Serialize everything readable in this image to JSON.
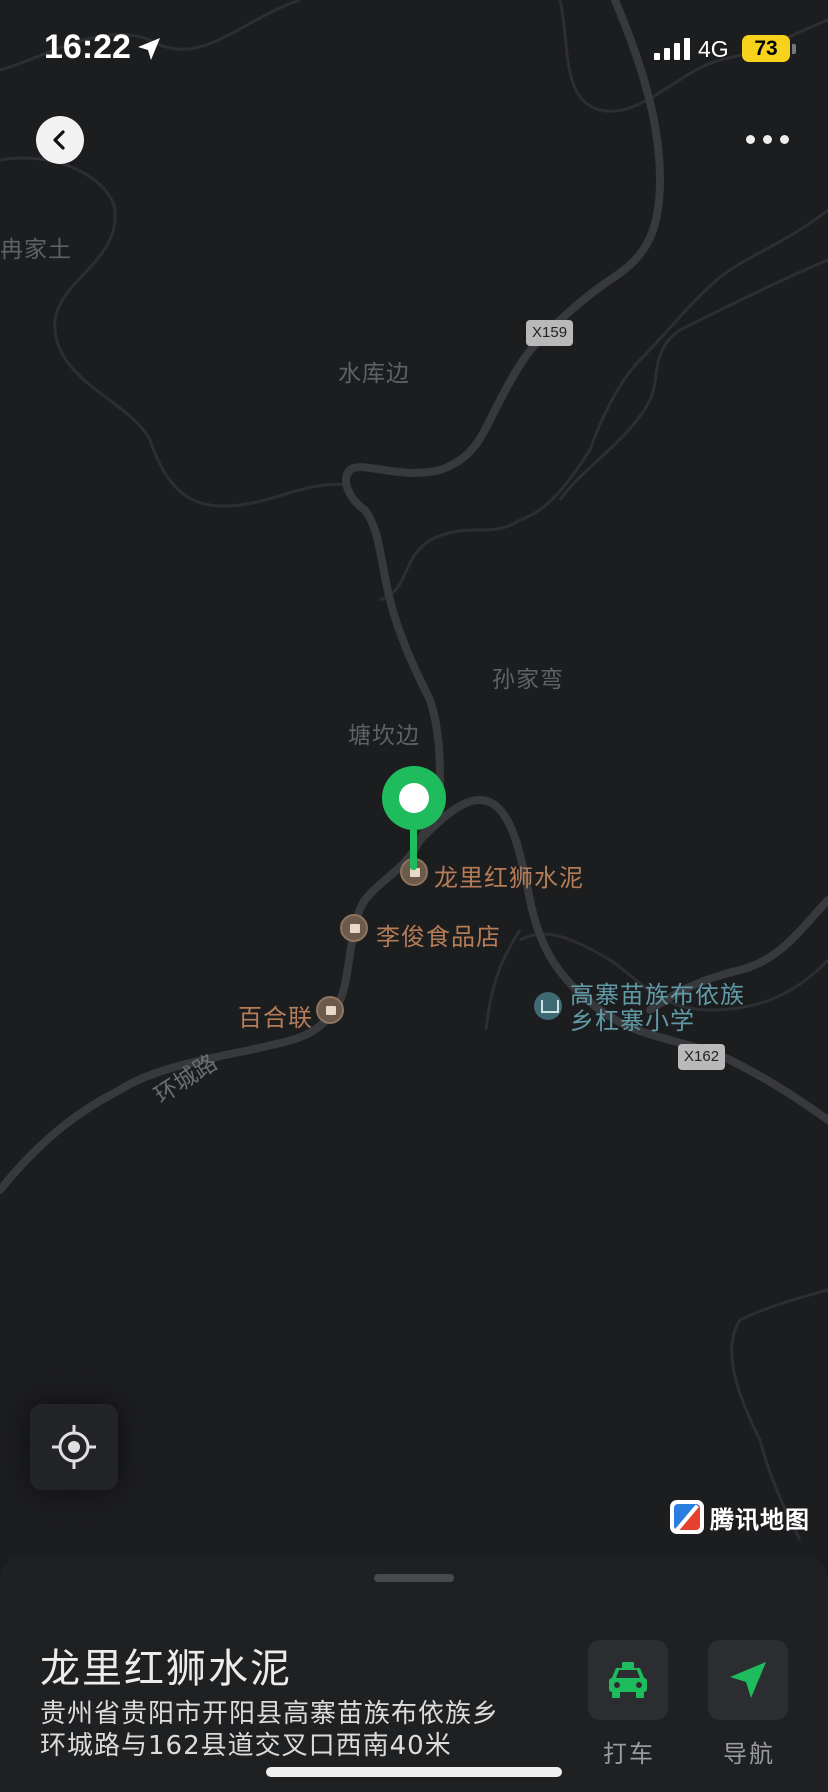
{
  "status_bar": {
    "time": "16:22",
    "network": "4G",
    "battery": "73",
    "battery_color": "#f7d21d"
  },
  "map": {
    "places": [
      "冉家土",
      "水库边",
      "孙家弯",
      "塘坎边"
    ],
    "road_shields": [
      "X159",
      "X162"
    ],
    "road_name": "环城路",
    "pois": [
      {
        "name": "龙里红狮水泥",
        "icon": "shop-icon"
      },
      {
        "name": "李俊食品店",
        "icon": "shop-icon"
      },
      {
        "name": "百合联",
        "icon": "shop-icon"
      }
    ],
    "school": {
      "line1": "高寨苗族布依族",
      "line2": "乡杠寨小学",
      "icon": "school-icon"
    },
    "brand": "腾讯地图",
    "pin_color": "#1fbc5e"
  },
  "sheet": {
    "title": "龙里红狮水泥",
    "address_line1": "贵州省贵阳市开阳县高寨苗族布依族乡",
    "address_line2": "环城路与162县道交叉口西南40米",
    "actions": [
      {
        "label": "打车",
        "icon": "taxi-icon"
      },
      {
        "label": "导航",
        "icon": "navigation-arrow-icon"
      }
    ]
  }
}
